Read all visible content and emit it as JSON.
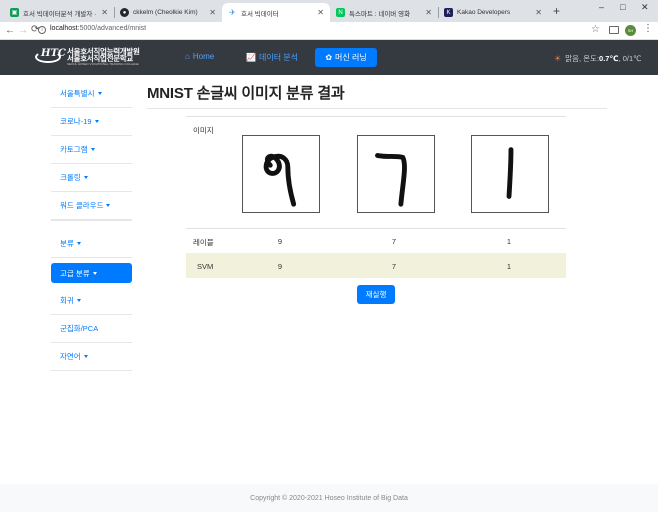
{
  "browser": {
    "tabs": [
      {
        "title": "호서 빅데이터분석 개발자 ·",
        "favicon_color": "#0f9d58",
        "favicon_glyph": "▣"
      },
      {
        "title": "ckkelm (Cheolkie Kim)",
        "favicon_color": "#24292e",
        "favicon_glyph": "●"
      },
      {
        "title": "호서 빅데이터",
        "favicon_color": "#ffffff",
        "favicon_glyph": "✈"
      },
      {
        "title": "특스마트 : 네이버 영화",
        "favicon_color": "#03c75a",
        "favicon_glyph": "N"
      },
      {
        "title": "Kakao Developers",
        "favicon_color": "#1e1e5a",
        "favicon_glyph": "K"
      }
    ],
    "new_tab_glyph": "+",
    "window_controls": {
      "minimize": "–",
      "maximize": "□",
      "close": "✕"
    },
    "url_host": "localhost",
    "url_path": ":5000/advanced/mnist",
    "avatar_text": "SH"
  },
  "navbar": {
    "logo_line1": "서울호서직업능력개발원",
    "logo_line2": "서울호서직업전문학교",
    "logo_line3": "SEOUL HOSEO VOCATIONAL TRAINING COLLEGE",
    "logo_mark": "HTC",
    "home_label": "Home",
    "analysis_label": "데이터 분석",
    "ml_label": "머신 러닝",
    "weather_prefix": "맑음, 온도: ",
    "weather_temp": "0.7℃",
    "weather_suffix": ", 0/1℃"
  },
  "sidebar": {
    "items": [
      {
        "label": "서울특별시",
        "dropdown": true
      },
      {
        "label": "코로나-19",
        "dropdown": true
      },
      {
        "label": "카토그램",
        "dropdown": true
      },
      {
        "label": "크롤링",
        "dropdown": true
      },
      {
        "label": "워드 클라우드",
        "dropdown": true
      },
      {
        "label": "분류",
        "dropdown": true
      },
      {
        "label": "고급 분류",
        "dropdown": true
      },
      {
        "label": "회귀",
        "dropdown": true
      },
      {
        "label": "군집화/PCA",
        "dropdown": false
      },
      {
        "label": "자연어",
        "dropdown": true
      }
    ]
  },
  "main": {
    "title": "MNIST 손글씨 이미지 분류 결과",
    "image_label": "이미지",
    "label_row_label": "레이블",
    "label_values": [
      "9",
      "7",
      "1"
    ],
    "svm_row_label": "SVM",
    "svm_values": [
      "9",
      "7",
      "1"
    ],
    "rerun_label": "재실행"
  },
  "footer": {
    "text": "Copyright © 2020-2021 Hoseo Institute of Big Data"
  },
  "colors": {
    "navbar_bg": "#343a40",
    "accent": "#007bff",
    "svm_row_bg": "#f2f2dc"
  }
}
